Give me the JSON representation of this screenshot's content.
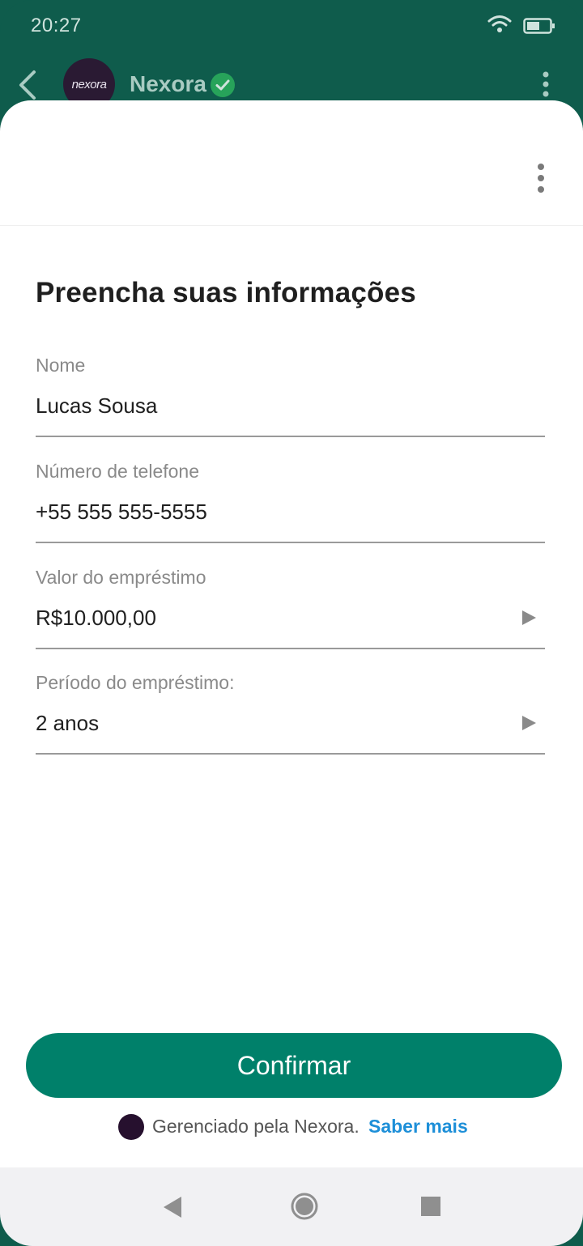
{
  "status_bar": {
    "time": "20:27"
  },
  "header": {
    "contact_name": "Nexora",
    "avatar_text": "nexora"
  },
  "form": {
    "title": "Preencha suas informações",
    "fields": [
      {
        "label": "Nome",
        "value": "Lucas Sousa"
      },
      {
        "label": "Número de telefone",
        "value": "+55 555 555-5555"
      },
      {
        "label": "Valor do empréstimo",
        "value": "R$10.000,00"
      },
      {
        "label": "Período do empréstimo:",
        "value": "2 anos"
      }
    ]
  },
  "confirm_label": "Confirmar",
  "footer": {
    "managed_text": "Gerenciado pela Nexora.",
    "learn_more": "Saber mais"
  },
  "colors": {
    "header_bg": "#0f5c4c",
    "accent": "#00806a",
    "link": "#1d8fd8",
    "verified": "#27a35a"
  }
}
